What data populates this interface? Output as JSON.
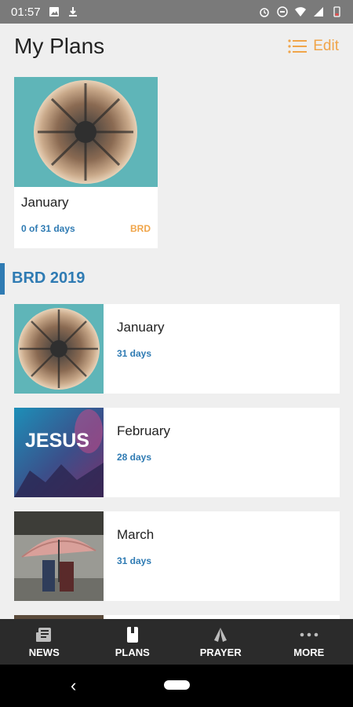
{
  "status_bar": {
    "time": "01:57"
  },
  "header": {
    "title": "My Plans",
    "edit_label": "Edit"
  },
  "featured_plan": {
    "title": "January",
    "progress": "0 of 31 days",
    "badge": "BRD"
  },
  "section": {
    "title": "BRD 2019"
  },
  "plans": [
    {
      "name": "January",
      "days": "31 days",
      "thumbnail": "tiny-planet-city"
    },
    {
      "name": "February",
      "days": "28 days",
      "thumbnail": "jesus-worship",
      "thumb_text": "JESUS"
    },
    {
      "name": "March",
      "days": "31 days",
      "thumbnail": "umbrella-street"
    }
  ],
  "bottom_nav": [
    {
      "label": "NEWS",
      "icon": "news-icon"
    },
    {
      "label": "PLANS",
      "icon": "book-icon"
    },
    {
      "label": "PRAYER",
      "icon": "praying-hands-icon"
    },
    {
      "label": "MORE",
      "icon": "more-dots-icon"
    }
  ],
  "colors": {
    "accent_blue": "#2f7bb3",
    "accent_orange": "#f0a54a",
    "nav_bg": "#2b2b2b"
  }
}
